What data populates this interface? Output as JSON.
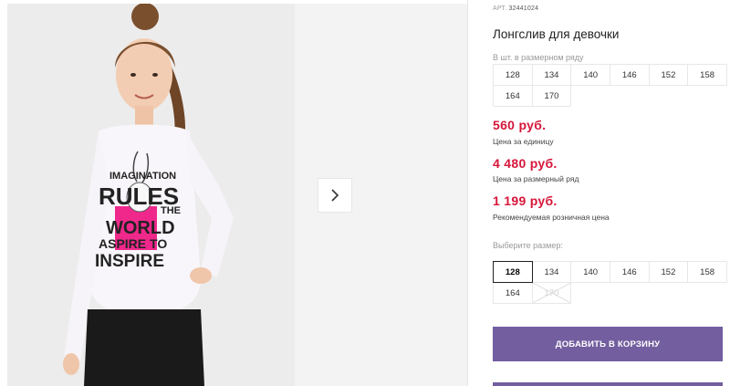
{
  "product": {
    "art_label": "АРТ.",
    "art_number": "32441024",
    "title": "Лонгслив для девочки"
  },
  "pack": {
    "label": "В шт. в размерном ряду",
    "sizes": [
      "128",
      "134",
      "140",
      "146",
      "152",
      "158",
      "164",
      "170"
    ]
  },
  "prices": {
    "unit_price": "560 руб.",
    "unit_caption": "Цена за единицу",
    "pack_price": "4 480 руб.",
    "pack_caption": "Цена за размерный ряд",
    "retail_price": "1 199 руб.",
    "retail_caption": "Рекомендуемая розничная цена"
  },
  "size_picker": {
    "label": "Выберите размер:",
    "sizes": [
      "128",
      "134",
      "140",
      "146",
      "152",
      "158",
      "164",
      "170"
    ],
    "selected": "128",
    "unavailable": "170"
  },
  "cart_button": "ДОБАВИТЬ В КОРЗИНУ",
  "image_print": {
    "line1": "IMAGINATION",
    "line2": "RULES",
    "line3": "THE",
    "line4": "WORLD",
    "line5": "ASPIRE TO",
    "line6": "INSPIRE"
  },
  "colors": {
    "price_red": "#d6163a",
    "button_purple": "#735e9f",
    "print_pink": "#f0288c"
  }
}
